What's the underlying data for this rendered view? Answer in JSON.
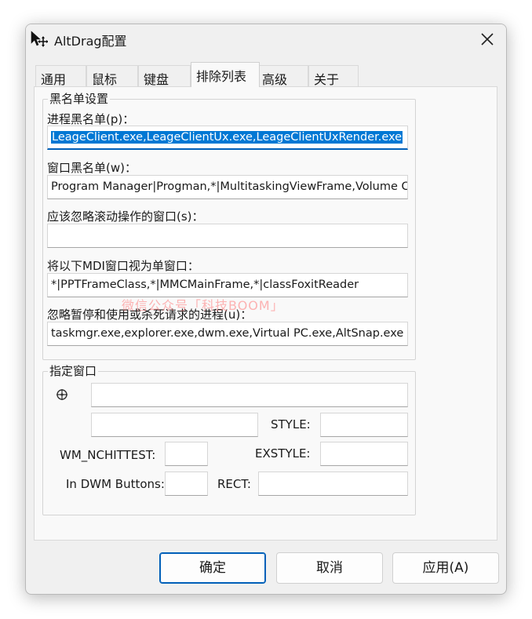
{
  "window": {
    "title": "AltDrag配置"
  },
  "tabs": [
    {
      "label": "通用"
    },
    {
      "label": "鼠标"
    },
    {
      "label": "键盘"
    },
    {
      "label": "排除列表"
    },
    {
      "label": "高级"
    },
    {
      "label": "关于"
    }
  ],
  "blacklist": {
    "group_title": "黑名单设置",
    "process_label": "进程黑名单(p)：",
    "process_value": "LeageClient.exe,LeageClientUx.exe,LeageClientUxRender.exe",
    "window_label": "窗口黑名单(w)：",
    "window_value": "Program Manager|Progman,*|MultitaskingViewFrame,Volume C",
    "scroll_label": "应该忽略滚动操作的窗口(s)：",
    "scroll_value": "",
    "mdi_label": "将以下MDI窗口视为单窗口：",
    "mdi_value": "*|PPTFrameClass,*|MMCMainFrame,*|classFoxitReader",
    "pause_label": "忽略暂停和使用或杀死请求的进程(u)：",
    "pause_value": "taskmgr.exe,explorer.exe,dwm.exe,Virtual PC.exe,AltSnap.exe"
  },
  "specify": {
    "group_title": "指定窗口",
    "style_label": "STYLE:",
    "wm_label": "WM_NCHITTEST:",
    "exstyle_label": "EXSTYLE:",
    "dwm_label": "In DWM Buttons:",
    "rect_label": "RECT:"
  },
  "buttons": {
    "ok": "确定",
    "cancel": "取消",
    "apply": "应用(A)"
  },
  "watermark": "微信公众号「科技BOOM」",
  "colors": {
    "accent": "#005fb8",
    "selection": "#0078d4"
  }
}
